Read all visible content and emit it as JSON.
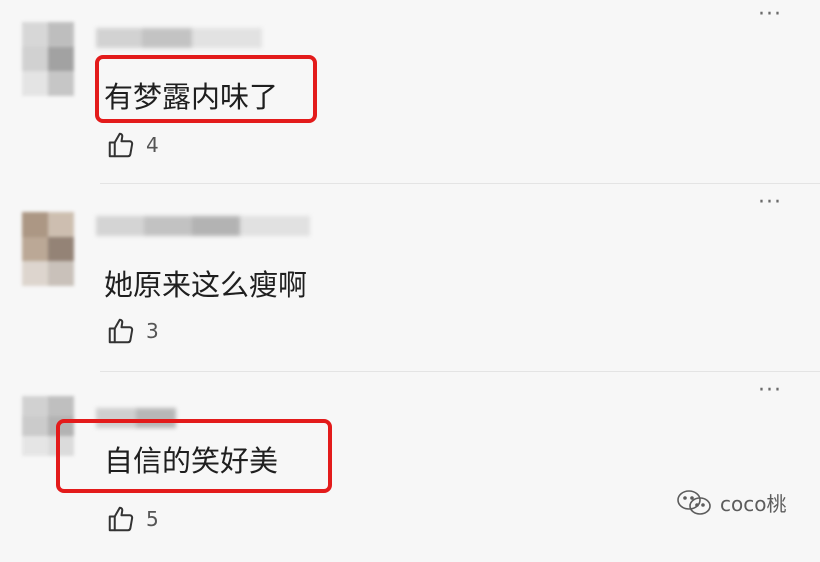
{
  "comments": [
    {
      "text": "有梦露内味了",
      "likes": "4",
      "highlighted": true
    },
    {
      "text": "她原来这么瘦啊",
      "likes": "3",
      "highlighted": false
    },
    {
      "text": "自信的笑好美",
      "likes": "5",
      "highlighted": true
    }
  ],
  "more_label": "···",
  "watermark": {
    "handle": "coco桃"
  },
  "icons": {
    "more": "more-icon",
    "like": "thumbs-up-icon",
    "watermark": "wechat-icon"
  },
  "colors": {
    "highlight": "#e31b1b",
    "background": "#f7f7f7"
  }
}
